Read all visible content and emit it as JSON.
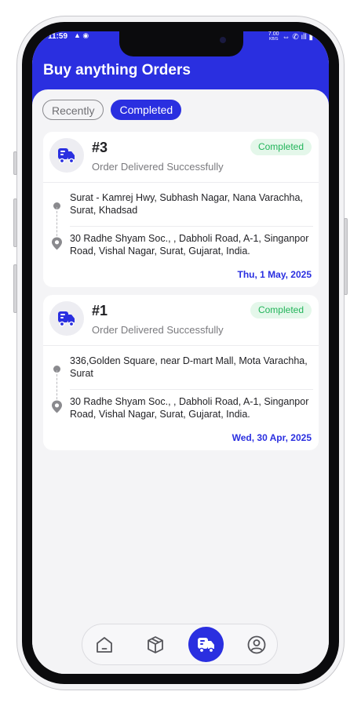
{
  "status_bar": {
    "time": "11:59",
    "left_icons": "▲ ◉",
    "speed_top": "7.00",
    "speed_unit": "KB/S",
    "right_icons": "⇔ ✆ ıll ▮"
  },
  "header": {
    "title": "Buy anything Orders"
  },
  "tabs": [
    {
      "label": "Recently",
      "active": false
    },
    {
      "label": "Completed",
      "active": true
    }
  ],
  "orders": [
    {
      "number": "#3",
      "status_text": "Order Delivered Successfully",
      "badge": "Completed",
      "pickup": "Surat - Kamrej Hwy, Subhash Nagar, Nana Varachha, Surat, Khadsad",
      "drop": "30 Radhe Shyam Soc., , Dabholi Road, A-1, Singanpor Road, Vishal Nagar, Surat, Gujarat, India.",
      "date": "Thu, 1 May, 2025"
    },
    {
      "number": "#1",
      "status_text": "Order Delivered Successfully",
      "badge": "Completed",
      "pickup": "336,Golden Square, near D-mart Mall, Mota Varachha, Surat",
      "drop": "30 Radhe Shyam Soc., , Dabholi Road, A-1, Singanpor Road, Vishal Nagar, Surat, Gujarat, India.",
      "date": "Wed, 30 Apr, 2025"
    }
  ],
  "bottom_nav": [
    {
      "icon": "home-icon",
      "active": false
    },
    {
      "icon": "box-icon",
      "active": false
    },
    {
      "icon": "delivery-truck-icon",
      "active": true
    },
    {
      "icon": "profile-icon",
      "active": false
    }
  ],
  "colors": {
    "primary": "#2a2fe0",
    "badge_bg": "#e4f7ea",
    "badge_text": "#22b45a",
    "screen_bg": "#f4f4f6"
  }
}
